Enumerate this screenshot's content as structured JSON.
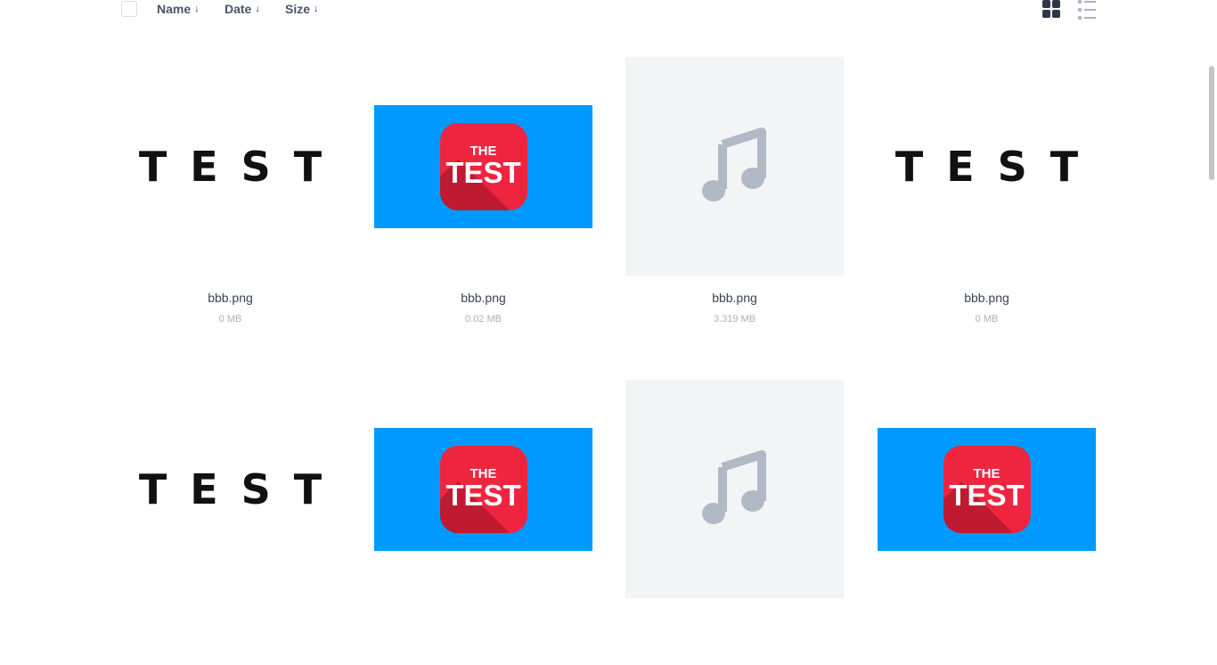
{
  "toolbar": {
    "sort_name": "Name",
    "sort_date": "Date",
    "sort_size": "Size",
    "sort_arrow": "↓"
  },
  "files": [
    {
      "name": "bbb.png",
      "size": "0 MB",
      "kind": "text",
      "thumb_text": "TEST"
    },
    {
      "name": "bbb.png",
      "size": "0.02 MB",
      "kind": "badge",
      "badge_top": "THE",
      "badge_main": "TEST"
    },
    {
      "name": "bbb.png",
      "size": "3.319 MB",
      "kind": "audio"
    },
    {
      "name": "bbb.png",
      "size": "0 MB",
      "kind": "text",
      "thumb_text": "TEST"
    },
    {
      "kind": "text",
      "thumb_text": "TEST"
    },
    {
      "kind": "badge",
      "badge_top": "THE",
      "badge_main": "TEST"
    },
    {
      "kind": "audio"
    },
    {
      "kind": "badge",
      "badge_top": "THE",
      "badge_main": "TEST"
    }
  ],
  "colors": {
    "banner": "#0099ff",
    "badge": "#ef2540",
    "audio_bg": "#f2f4f6",
    "audio_icon": "#b1b9c6"
  }
}
